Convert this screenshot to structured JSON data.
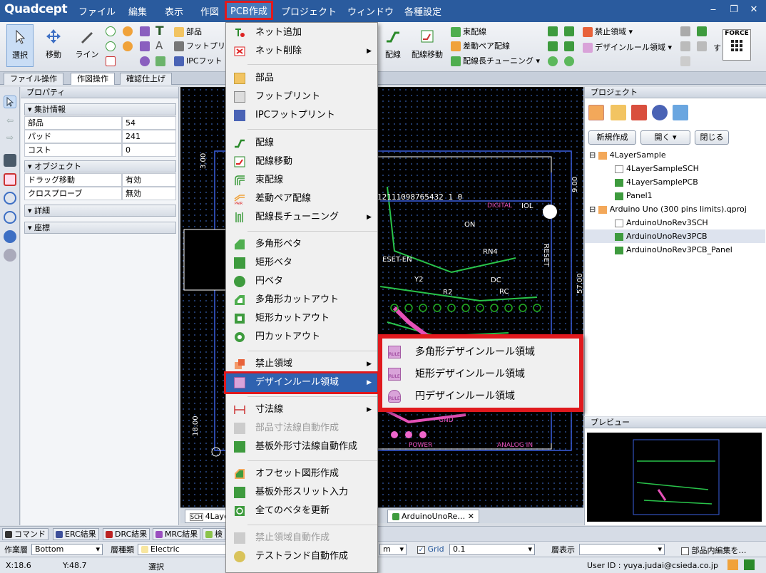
{
  "app": {
    "title": "Quadcept"
  },
  "menubar": {
    "items": [
      "ファイル",
      "編集",
      "表示",
      "作図",
      "PCB作成",
      "プロジェクト",
      "ウィンドウ",
      "各種設定"
    ],
    "window_controls": [
      "‒",
      "❐",
      "✕"
    ]
  },
  "ribbon": {
    "select_label": "選択",
    "move_label": "移動",
    "line_label": "ライン",
    "part_label": "部品",
    "footprint_label": "フットプリ",
    "ipc_label": "IPCフット",
    "route_label": "配線",
    "route_move_label": "配線移動",
    "bundle_label": "束配線",
    "diffpair_label": "差動ペア配線",
    "tuning_label": "配線長チューニング",
    "keepout_label": "禁止領域",
    "design_rule_label": "デザインルール領域",
    "force_label": "FORCE"
  },
  "ribbon_tabs": [
    "ファイル操作",
    "作図操作",
    "確認仕上げ"
  ],
  "properties": {
    "title": "プロパティ",
    "group_stats": "集計情報",
    "stats": [
      {
        "key": "部品",
        "value": "54"
      },
      {
        "key": "パッド",
        "value": "241"
      },
      {
        "key": "コスト",
        "value": "0"
      }
    ],
    "group_object": "オブジェクト",
    "object_rows": [
      {
        "key": "ドラッグ移動",
        "value": "有効"
      },
      {
        "key": "クロスプローブ",
        "value": "無効"
      }
    ],
    "group_detail": "詳細",
    "group_coords": "座標"
  },
  "dropdown": {
    "items": [
      {
        "label": "ネット追加",
        "icon": "net-add-icon"
      },
      {
        "label": "ネット削除",
        "icon": "net-delete-icon",
        "submenu": true
      },
      {
        "label": "部品",
        "icon": "part-icon"
      },
      {
        "label": "フットプリント",
        "icon": "footprint-icon"
      },
      {
        "label": "IPCフットプリント",
        "icon": "ipc-footprint-icon"
      },
      {
        "label": "配線",
        "icon": "route-icon"
      },
      {
        "label": "配線移動",
        "icon": "route-move-icon"
      },
      {
        "label": "束配線",
        "icon": "bundle-route-icon"
      },
      {
        "label": "差動ペア配線",
        "icon": "diff-pair-icon"
      },
      {
        "label": "配線長チューニング",
        "icon": "length-tuning-icon",
        "submenu": true
      },
      {
        "label": "多角形ベタ",
        "icon": "polygon-fill-icon"
      },
      {
        "label": "矩形ベタ",
        "icon": "rect-fill-icon"
      },
      {
        "label": "円ベタ",
        "icon": "circle-fill-icon"
      },
      {
        "label": "多角形カットアウト",
        "icon": "polygon-cutout-icon"
      },
      {
        "label": "矩形カットアウト",
        "icon": "rect-cutout-icon"
      },
      {
        "label": "円カットアウト",
        "icon": "circle-cutout-icon"
      },
      {
        "label": "禁止領域",
        "icon": "keepout-icon",
        "submenu": true
      },
      {
        "label": "デザインルール領域",
        "icon": "design-rule-icon",
        "submenu": true
      },
      {
        "label": "寸法線",
        "icon": "dimension-icon",
        "submenu": true
      },
      {
        "label": "部品寸法線自動作成",
        "icon": "auto-part-dimension-icon",
        "disabled": true
      },
      {
        "label": "基板外形寸法線自動作成",
        "icon": "auto-board-dimension-icon"
      },
      {
        "label": "オフセット図形作成",
        "icon": "offset-shape-icon"
      },
      {
        "label": "基板外形スリット入力",
        "icon": "board-slit-icon"
      },
      {
        "label": "全てのベタを更新",
        "icon": "update-fills-icon"
      },
      {
        "label": "禁止領域自動作成",
        "icon": "auto-keepout-icon",
        "disabled": true
      },
      {
        "label": "テストランド自動作成",
        "icon": "test-land-icon"
      }
    ]
  },
  "submenu": {
    "items": [
      "多角形デザインルール領域",
      "矩形デザインルール領域",
      "円デザインルール領域"
    ],
    "icon_text": "RULE"
  },
  "project": {
    "title": "プロジェクト",
    "buttons": [
      "新規作成",
      "開く",
      "閉じる"
    ],
    "tree": [
      {
        "label": "4LayerSample",
        "type": "project"
      },
      {
        "label": "4LayerSampleSCH",
        "type": "sch"
      },
      {
        "label": "4LayerSamplePCB",
        "type": "pcb"
      },
      {
        "label": "Panel1",
        "type": "pcb"
      },
      {
        "label": "Arduino Uno (300 pins limits).qproj",
        "type": "project"
      },
      {
        "label": "ArduinoUnoRev3SCH",
        "type": "sch"
      },
      {
        "label": "ArduinoUnoRev3PCB",
        "type": "pcb",
        "selected": true
      },
      {
        "label": "ArduinoUnoRev3PCB_Panel",
        "type": "pcb"
      }
    ]
  },
  "preview": {
    "title": "プレビュー"
  },
  "canvas": {
    "dims": [
      "3.00",
      "57.00",
      "9.00",
      "18.00"
    ],
    "labels": [
      "DIGITAL",
      "IOL",
      "ON",
      "RN4",
      "ESET-EN",
      "Y2",
      "R2",
      "DC",
      "RC",
      "RESET",
      "GND",
      "POWER",
      "ANALOG IN",
      "12111098765432 1 0"
    ]
  },
  "doc_tabs": [
    "4Layer",
    "ArduinoUnoRe…"
  ],
  "output_tabs": [
    "コマンド",
    "ERC結果",
    "DRC結果",
    "MRC結果",
    "検"
  ],
  "layer_bar": {
    "work_layer_label": "作業層",
    "work_layer_value": "Bottom",
    "layer_type_label": "層種類",
    "layer_type_value": "Electric",
    "unit_value": "m",
    "grid_label": "Grid",
    "grid_value": "0.1",
    "layer_display_label": "層表示",
    "inline_edit_label": "部品内編集を…"
  },
  "status": {
    "x": "X:18.6",
    "y": "Y:48.7",
    "mode": "選択",
    "user": "User ID : yuya.judai@csieda.co.jp"
  },
  "colors": {
    "titlebar": "#2a5b9e",
    "highlight": "#2f62b0",
    "callout_red": "#e0191d",
    "pcb_green": "#29c34a",
    "pcb_blue": "#3a5fe0",
    "pcb_pink": "#e651b8"
  }
}
